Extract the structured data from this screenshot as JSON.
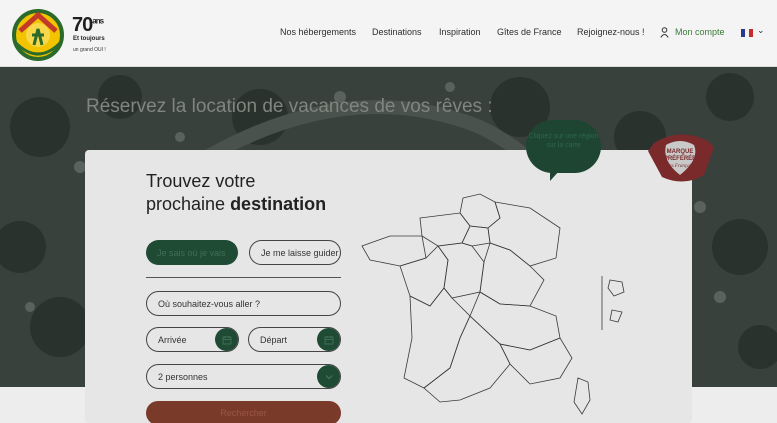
{
  "brand": {
    "logo_text": "GÎTES DE FRANCE",
    "anniversary_number": "70",
    "anniversary_suffix": "ans",
    "anniversary_tagline": "Et toujours",
    "anniversary_sub": "un grand OUI !"
  },
  "nav": {
    "items": [
      "Nos hébergements",
      "Destinations",
      "Inspiration",
      "Gîtes de France",
      "Rejoignez-nous !"
    ],
    "account_label": "Mon compte",
    "language_flag": [
      "#2a3a8a",
      "#f2f2f2",
      "#c62a2a"
    ]
  },
  "hero": {
    "title": "Réservez la location de vacances de vos rêves :"
  },
  "search": {
    "heading_line1": "Trouvez votre",
    "heading_line2_prefix": "prochaine ",
    "heading_line2_bold": "destination",
    "tab_know": "Je sais où je vais",
    "tab_guide": "Je me laisse guider",
    "where_placeholder": "Où souhaitez-vous aller ?",
    "arrival_label": "Arrivée",
    "departure_label": "Départ",
    "guests_value": "2 personnes",
    "search_button": "Rechercher"
  },
  "map": {
    "bubble_text": "Cliquez sur une région sur la carte"
  },
  "badge": {
    "text_line1": "MARQUE",
    "text_line2": "PRÉFÉRÉE",
    "text_line3": "des Français"
  },
  "colors": {
    "accent_green": "#1f4a34",
    "search_red": "#7a3a2a",
    "account_green": "#3b7a3a"
  }
}
